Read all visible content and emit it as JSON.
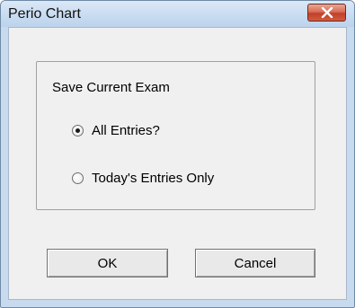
{
  "window": {
    "title": "Perio Chart"
  },
  "dialog": {
    "group_label": "Save Current Exam",
    "options": [
      {
        "label": "All Entries?",
        "selected": true
      },
      {
        "label": "Today's Entries Only",
        "selected": false
      }
    ],
    "ok_label": "OK",
    "cancel_label": "Cancel"
  },
  "icons": {
    "close": "close-icon"
  },
  "colors": {
    "close_button": "#c9452c",
    "dialog_background": "#f0f0f0",
    "frame": "#c8daee"
  }
}
